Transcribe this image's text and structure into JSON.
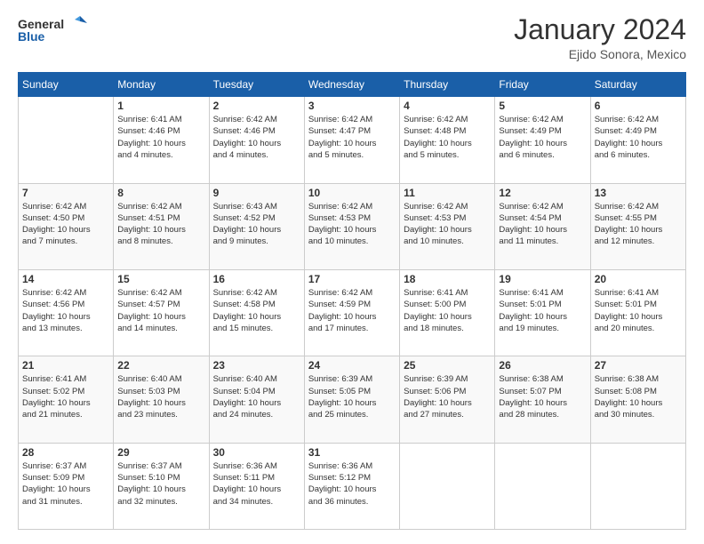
{
  "logo": {
    "line1": "General",
    "line2": "Blue"
  },
  "title": "January 2024",
  "subtitle": "Ejido Sonora, Mexico",
  "days_header": [
    "Sunday",
    "Monday",
    "Tuesday",
    "Wednesday",
    "Thursday",
    "Friday",
    "Saturday"
  ],
  "weeks": [
    [
      {
        "num": "",
        "info": ""
      },
      {
        "num": "1",
        "info": "Sunrise: 6:41 AM\nSunset: 4:46 PM\nDaylight: 10 hours\nand 4 minutes."
      },
      {
        "num": "2",
        "info": "Sunrise: 6:42 AM\nSunset: 4:46 PM\nDaylight: 10 hours\nand 4 minutes."
      },
      {
        "num": "3",
        "info": "Sunrise: 6:42 AM\nSunset: 4:47 PM\nDaylight: 10 hours\nand 5 minutes."
      },
      {
        "num": "4",
        "info": "Sunrise: 6:42 AM\nSunset: 4:48 PM\nDaylight: 10 hours\nand 5 minutes."
      },
      {
        "num": "5",
        "info": "Sunrise: 6:42 AM\nSunset: 4:49 PM\nDaylight: 10 hours\nand 6 minutes."
      },
      {
        "num": "6",
        "info": "Sunrise: 6:42 AM\nSunset: 4:49 PM\nDaylight: 10 hours\nand 6 minutes."
      }
    ],
    [
      {
        "num": "7",
        "info": "Sunrise: 6:42 AM\nSunset: 4:50 PM\nDaylight: 10 hours\nand 7 minutes."
      },
      {
        "num": "8",
        "info": "Sunrise: 6:42 AM\nSunset: 4:51 PM\nDaylight: 10 hours\nand 8 minutes."
      },
      {
        "num": "9",
        "info": "Sunrise: 6:43 AM\nSunset: 4:52 PM\nDaylight: 10 hours\nand 9 minutes."
      },
      {
        "num": "10",
        "info": "Sunrise: 6:42 AM\nSunset: 4:53 PM\nDaylight: 10 hours\nand 10 minutes."
      },
      {
        "num": "11",
        "info": "Sunrise: 6:42 AM\nSunset: 4:53 PM\nDaylight: 10 hours\nand 10 minutes."
      },
      {
        "num": "12",
        "info": "Sunrise: 6:42 AM\nSunset: 4:54 PM\nDaylight: 10 hours\nand 11 minutes."
      },
      {
        "num": "13",
        "info": "Sunrise: 6:42 AM\nSunset: 4:55 PM\nDaylight: 10 hours\nand 12 minutes."
      }
    ],
    [
      {
        "num": "14",
        "info": "Sunrise: 6:42 AM\nSunset: 4:56 PM\nDaylight: 10 hours\nand 13 minutes."
      },
      {
        "num": "15",
        "info": "Sunrise: 6:42 AM\nSunset: 4:57 PM\nDaylight: 10 hours\nand 14 minutes."
      },
      {
        "num": "16",
        "info": "Sunrise: 6:42 AM\nSunset: 4:58 PM\nDaylight: 10 hours\nand 15 minutes."
      },
      {
        "num": "17",
        "info": "Sunrise: 6:42 AM\nSunset: 4:59 PM\nDaylight: 10 hours\nand 17 minutes."
      },
      {
        "num": "18",
        "info": "Sunrise: 6:41 AM\nSunset: 5:00 PM\nDaylight: 10 hours\nand 18 minutes."
      },
      {
        "num": "19",
        "info": "Sunrise: 6:41 AM\nSunset: 5:01 PM\nDaylight: 10 hours\nand 19 minutes."
      },
      {
        "num": "20",
        "info": "Sunrise: 6:41 AM\nSunset: 5:01 PM\nDaylight: 10 hours\nand 20 minutes."
      }
    ],
    [
      {
        "num": "21",
        "info": "Sunrise: 6:41 AM\nSunset: 5:02 PM\nDaylight: 10 hours\nand 21 minutes."
      },
      {
        "num": "22",
        "info": "Sunrise: 6:40 AM\nSunset: 5:03 PM\nDaylight: 10 hours\nand 23 minutes."
      },
      {
        "num": "23",
        "info": "Sunrise: 6:40 AM\nSunset: 5:04 PM\nDaylight: 10 hours\nand 24 minutes."
      },
      {
        "num": "24",
        "info": "Sunrise: 6:39 AM\nSunset: 5:05 PM\nDaylight: 10 hours\nand 25 minutes."
      },
      {
        "num": "25",
        "info": "Sunrise: 6:39 AM\nSunset: 5:06 PM\nDaylight: 10 hours\nand 27 minutes."
      },
      {
        "num": "26",
        "info": "Sunrise: 6:38 AM\nSunset: 5:07 PM\nDaylight: 10 hours\nand 28 minutes."
      },
      {
        "num": "27",
        "info": "Sunrise: 6:38 AM\nSunset: 5:08 PM\nDaylight: 10 hours\nand 30 minutes."
      }
    ],
    [
      {
        "num": "28",
        "info": "Sunrise: 6:37 AM\nSunset: 5:09 PM\nDaylight: 10 hours\nand 31 minutes."
      },
      {
        "num": "29",
        "info": "Sunrise: 6:37 AM\nSunset: 5:10 PM\nDaylight: 10 hours\nand 32 minutes."
      },
      {
        "num": "30",
        "info": "Sunrise: 6:36 AM\nSunset: 5:11 PM\nDaylight: 10 hours\nand 34 minutes."
      },
      {
        "num": "31",
        "info": "Sunrise: 6:36 AM\nSunset: 5:12 PM\nDaylight: 10 hours\nand 36 minutes."
      },
      {
        "num": "",
        "info": ""
      },
      {
        "num": "",
        "info": ""
      },
      {
        "num": "",
        "info": ""
      }
    ]
  ]
}
